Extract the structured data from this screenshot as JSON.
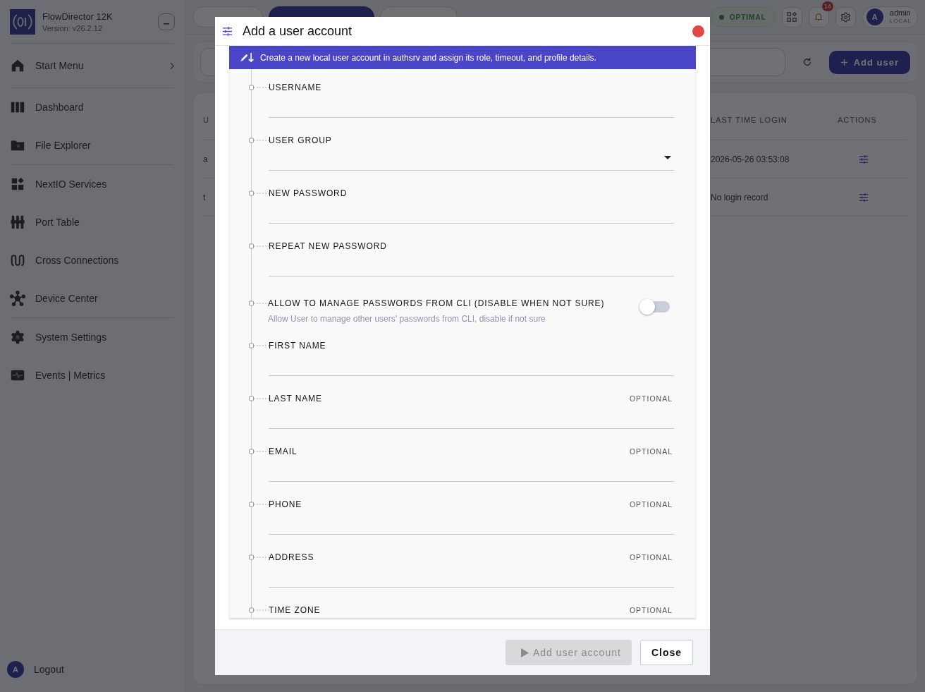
{
  "app": {
    "title": "FlowDirector 12K",
    "version": "Version: v26.2.12"
  },
  "sidebar": {
    "sections": [
      {
        "items": [
          {
            "label": "Start Menu",
            "has_submenu": true
          }
        ]
      },
      {
        "items": [
          {
            "label": "Dashboard",
            "has_submenu": false
          },
          {
            "label": "File Explorer",
            "has_submenu": false
          }
        ]
      },
      {
        "items": [
          {
            "label": "NextIO Services",
            "has_submenu": false
          },
          {
            "label": "Port Table",
            "has_submenu": false
          },
          {
            "label": "Cross Connections",
            "has_submenu": false
          },
          {
            "label": "Device Center",
            "has_submenu": false
          }
        ]
      },
      {
        "items": [
          {
            "label": "System Settings",
            "has_submenu": false
          },
          {
            "label": "Events | Metrics",
            "has_submenu": false
          }
        ]
      }
    ],
    "logout": {
      "avatar": "A",
      "label": "Logout"
    }
  },
  "tabs": [
    {
      "selected": false
    },
    {
      "selected": true
    },
    {
      "selected": false
    }
  ],
  "status": {
    "label": "OPTIMAL"
  },
  "notifications": {
    "count": "14"
  },
  "user": {
    "avatar": "A",
    "name": "admin",
    "realm": "LOCAL"
  },
  "toolbar": {
    "add_button": "Add user"
  },
  "table": {
    "columns": [
      "U",
      "LAST TIME LOGIN",
      "ACTIONS"
    ],
    "rows": [
      {
        "column_1": "a",
        "last_login": "2026-05-26 03:53:08"
      },
      {
        "column_1": "t",
        "last_login": "No login record"
      }
    ]
  },
  "dialog": {
    "title": "Add a user account",
    "banner": "Create a new local user account in authsrv and assign its role, timeout, and profile details.",
    "fields": [
      {
        "kind": "text",
        "label": "USERNAME"
      },
      {
        "kind": "select",
        "label": "USER GROUP"
      },
      {
        "kind": "text",
        "label": "NEW PASSWORD"
      },
      {
        "kind": "text",
        "label": "REPEAT NEW PASSWORD"
      },
      {
        "kind": "toggle",
        "label": "ALLOW TO MANAGE PASSWORDS FROM CLI (DISABLE WHEN NOT SURE)",
        "description": "Allow User to manage other users' passwords from CLI, disable if not sure",
        "on": false
      },
      {
        "kind": "text",
        "label": "FIRST NAME"
      },
      {
        "kind": "text",
        "label": "LAST NAME",
        "tag": "OPTIONAL"
      },
      {
        "kind": "text",
        "label": "EMAIL",
        "tag": "OPTIONAL"
      },
      {
        "kind": "text",
        "label": "PHONE",
        "tag": "OPTIONAL"
      },
      {
        "kind": "text",
        "label": "ADDRESS",
        "tag": "OPTIONAL"
      },
      {
        "kind": "text",
        "label": "TIME ZONE",
        "tag": "OPTIONAL"
      }
    ],
    "submit": {
      "label": "Add user account",
      "disabled": true
    },
    "close": "Close"
  }
}
